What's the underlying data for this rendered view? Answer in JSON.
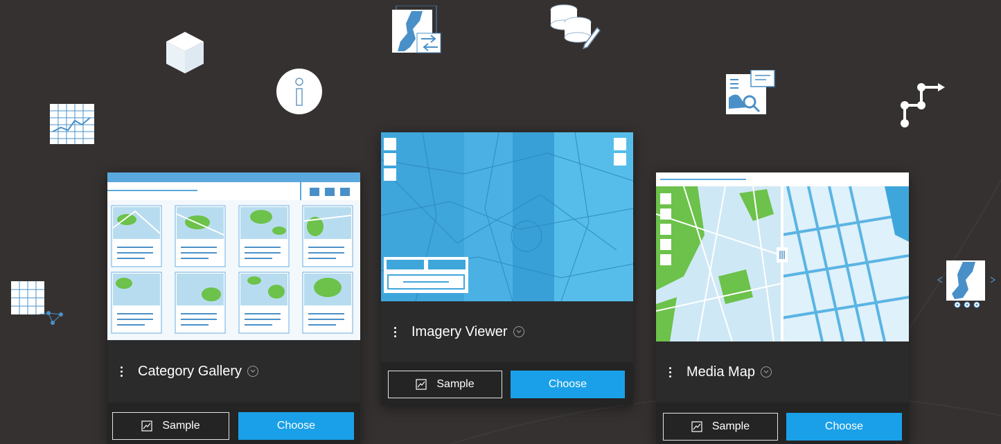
{
  "icons": {
    "cube": "cube-icon",
    "info": "info-icon",
    "chart_table": "chart-table-icon",
    "grid_network": "grid-network-icon",
    "map_swap": "map-swap-icon",
    "database_edit": "database-edit-icon",
    "doc_search": "document-search-icon",
    "route": "route-icon",
    "map_carousel": "map-carousel-icon"
  },
  "colors": {
    "background": "#353131",
    "accent": "#1aa0e8",
    "card": "#2b2b2b",
    "icon_fill": "#e6f0f8",
    "icon_stroke": "#4a90c8"
  },
  "cards": [
    {
      "title": "Category Gallery",
      "sample_label": "Sample",
      "choose_label": "Choose"
    },
    {
      "title": "Imagery Viewer",
      "sample_label": "Sample",
      "choose_label": "Choose"
    },
    {
      "title": "Media Map",
      "sample_label": "Sample",
      "choose_label": "Choose"
    }
  ]
}
